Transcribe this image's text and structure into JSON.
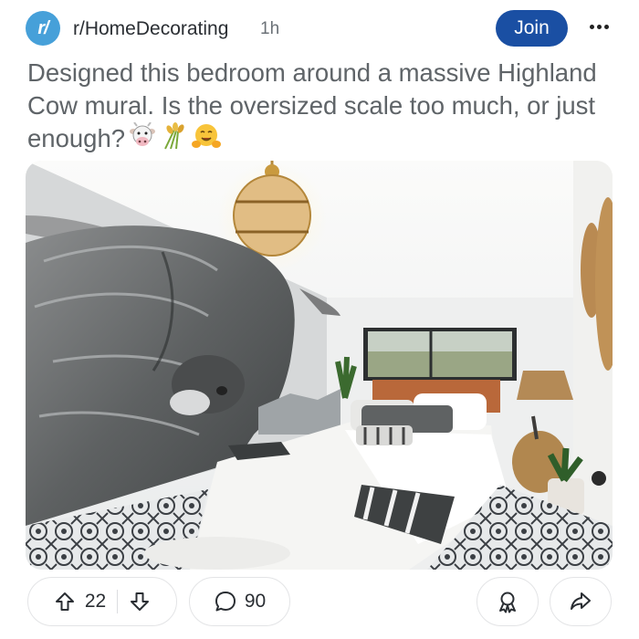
{
  "post": {
    "subreddit": "r/HomeDecorating",
    "age": "1h",
    "join_label": "Join",
    "title": "Designed this bedroom around a massive Highland Cow mural. Is the oversized scale too much, or just enough?",
    "title_emojis": [
      "cow-face",
      "rice-sheaf",
      "hugging-face"
    ]
  },
  "actions": {
    "upvotes": "22",
    "comments": "90"
  },
  "icons": {
    "avatar": "subreddit-avatar-icon",
    "more": "more-options-icon",
    "upvote": "upvote-arrow-icon",
    "downvote": "downvote-arrow-icon",
    "comment": "comment-bubble-icon",
    "award": "award-icon",
    "share": "share-icon"
  },
  "colors": {
    "join_button": "#1a4fa3",
    "avatar": "#46a0d9",
    "title_text": "#5f6468"
  }
}
